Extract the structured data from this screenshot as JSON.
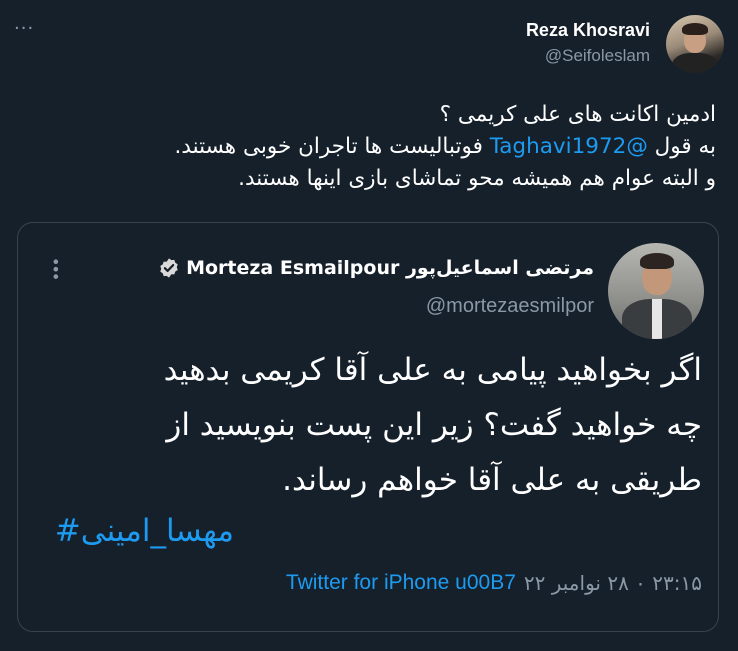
{
  "tweet": {
    "author_name": "Reza Khosravi",
    "author_handle": "@Seifoleslam",
    "more_glyph": "···",
    "line1": "ادمین اکانت های علی کریمی ؟",
    "line2_prefix": "به قول ",
    "line2_mention": "@Taghavi1972",
    "line2_suffix": " فوتبالیست ها تاجران خوبی هستند.",
    "line3": "و البته عوام هم همیشه محو تماشای بازی اینها هستند."
  },
  "quote": {
    "author_name": "مرتضی اسماعیل‌پور Morteza Esmailpour",
    "author_handle": "@mortezaesmilpor",
    "text_line1": "اگر بخواهید پیامی به علی آقا کریمی بدهید",
    "text_line2": "چه خواهید گفت؟ زیر این پست بنویسید از",
    "text_line3": "طریقی به علی آقا خواهم رساند.",
    "hashtag": "مهسا_امینی#",
    "timestamp": "۲۳:۱۵ ۰ ۲۸ نوامبر ۲۲",
    "source": "Twitter for iPhone u00B7"
  },
  "colors": {
    "background": "#15202b",
    "link": "#1d9bf0",
    "muted": "#8b98a5",
    "border": "#38444d"
  },
  "icons": {
    "more": "more-horizontal-icon",
    "verified": "verified-badge-icon"
  }
}
